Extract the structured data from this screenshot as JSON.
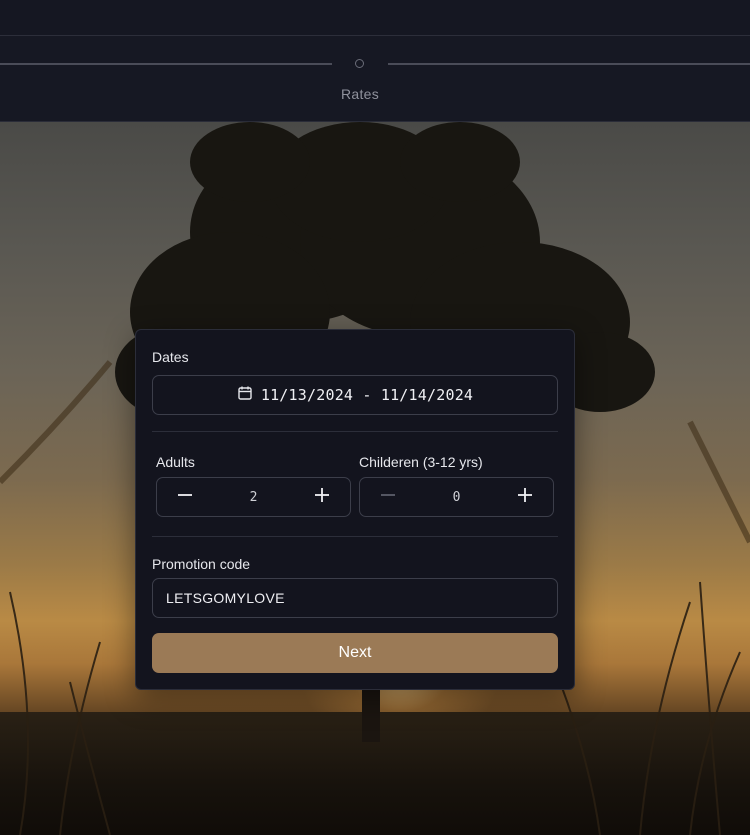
{
  "header": {
    "step_label": "Rates"
  },
  "booking": {
    "dates_label": "Dates",
    "dates_value": "11/13/2024 - 11/14/2024",
    "adults": {
      "label": "Adults",
      "value": "2"
    },
    "children": {
      "label": "Childeren (3-12 yrs)",
      "value": "0"
    },
    "promo_label": "Promotion code",
    "promo_value": "LETSGOMYLOVE",
    "next_label": "Next"
  },
  "colors": {
    "accent": "#9b7a56",
    "panel": "#13141e",
    "header_bg": "#161823"
  },
  "icons": {
    "dates": "calendar-icon",
    "decrement": "minus-icon",
    "increment": "plus-icon"
  }
}
